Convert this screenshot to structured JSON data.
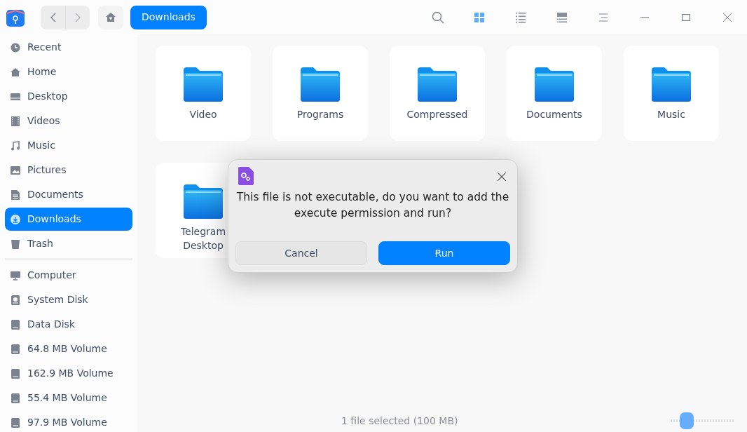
{
  "toolbar": {
    "location": "Downloads",
    "view_modes": [
      {
        "kind": "icon",
        "selected": true
      },
      {
        "kind": "list",
        "selected": false
      },
      {
        "kind": "tree",
        "selected": false
      }
    ]
  },
  "sidebar": {
    "groups": [
      [
        {
          "label": "Recent",
          "kind": "recent",
          "selected": false
        },
        {
          "label": "Home",
          "kind": "home",
          "selected": false
        },
        {
          "label": "Desktop",
          "kind": "desktop",
          "selected": false
        },
        {
          "label": "Videos",
          "kind": "videos",
          "selected": false
        },
        {
          "label": "Music",
          "kind": "music",
          "selected": false
        },
        {
          "label": "Pictures",
          "kind": "pictures",
          "selected": false
        },
        {
          "label": "Documents",
          "kind": "documents",
          "selected": false
        },
        {
          "label": "Downloads",
          "kind": "downloads",
          "selected": true
        },
        {
          "label": "Trash",
          "kind": "trash",
          "selected": false
        }
      ],
      [
        {
          "label": "Computer",
          "kind": "computer",
          "selected": false
        },
        {
          "label": "System Disk",
          "kind": "sysdisk",
          "selected": false
        },
        {
          "label": "Data Disk",
          "kind": "disk",
          "selected": false
        },
        {
          "label": "64.8 MB Volume",
          "kind": "disk",
          "selected": false
        },
        {
          "label": "162.9 MB Volume",
          "kind": "disk",
          "selected": false
        },
        {
          "label": "55.4 MB Volume",
          "kind": "disk",
          "selected": false
        },
        {
          "label": "97.9 MB Volume",
          "kind": "disk",
          "selected": false
        }
      ]
    ]
  },
  "files": [
    {
      "name": "Video"
    },
    {
      "name": "Programs"
    },
    {
      "name": "Compressed"
    },
    {
      "name": "Documents"
    },
    {
      "name": "Music"
    },
    {
      "name": "Telegram Desktop"
    }
  ],
  "status_bar": {
    "text": "1 file selected (100 MB)",
    "zoom": {
      "level": 0.25
    }
  },
  "dialog": {
    "message": "This file is not executable, do you want to add the execute permission and run?",
    "buttons": [
      {
        "label": "Cancel",
        "kind": "secondary"
      },
      {
        "label": "Run",
        "kind": "primary"
      }
    ]
  }
}
